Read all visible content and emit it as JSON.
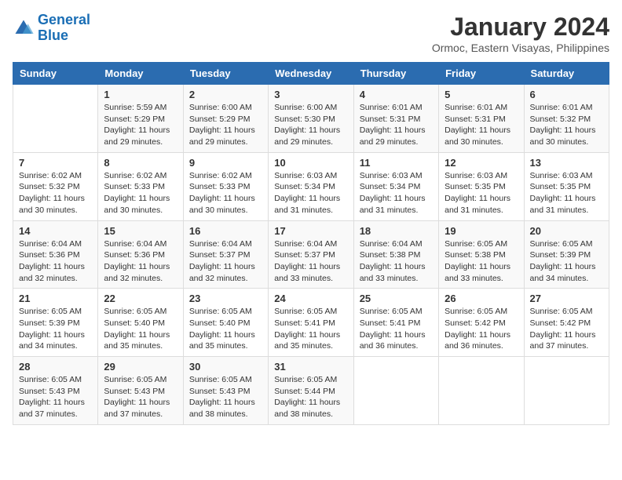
{
  "header": {
    "logo_line1": "General",
    "logo_line2": "Blue",
    "title": "January 2024",
    "subtitle": "Ormoc, Eastern Visayas, Philippines"
  },
  "days_of_week": [
    "Sunday",
    "Monday",
    "Tuesday",
    "Wednesday",
    "Thursday",
    "Friday",
    "Saturday"
  ],
  "weeks": [
    [
      {
        "day": "",
        "content": ""
      },
      {
        "day": "1",
        "content": "Sunrise: 5:59 AM\nSunset: 5:29 PM\nDaylight: 11 hours\nand 29 minutes."
      },
      {
        "day": "2",
        "content": "Sunrise: 6:00 AM\nSunset: 5:29 PM\nDaylight: 11 hours\nand 29 minutes."
      },
      {
        "day": "3",
        "content": "Sunrise: 6:00 AM\nSunset: 5:30 PM\nDaylight: 11 hours\nand 29 minutes."
      },
      {
        "day": "4",
        "content": "Sunrise: 6:01 AM\nSunset: 5:31 PM\nDaylight: 11 hours\nand 29 minutes."
      },
      {
        "day": "5",
        "content": "Sunrise: 6:01 AM\nSunset: 5:31 PM\nDaylight: 11 hours\nand 30 minutes."
      },
      {
        "day": "6",
        "content": "Sunrise: 6:01 AM\nSunset: 5:32 PM\nDaylight: 11 hours\nand 30 minutes."
      }
    ],
    [
      {
        "day": "7",
        "content": "Sunrise: 6:02 AM\nSunset: 5:32 PM\nDaylight: 11 hours\nand 30 minutes."
      },
      {
        "day": "8",
        "content": "Sunrise: 6:02 AM\nSunset: 5:33 PM\nDaylight: 11 hours\nand 30 minutes."
      },
      {
        "day": "9",
        "content": "Sunrise: 6:02 AM\nSunset: 5:33 PM\nDaylight: 11 hours\nand 30 minutes."
      },
      {
        "day": "10",
        "content": "Sunrise: 6:03 AM\nSunset: 5:34 PM\nDaylight: 11 hours\nand 31 minutes."
      },
      {
        "day": "11",
        "content": "Sunrise: 6:03 AM\nSunset: 5:34 PM\nDaylight: 11 hours\nand 31 minutes."
      },
      {
        "day": "12",
        "content": "Sunrise: 6:03 AM\nSunset: 5:35 PM\nDaylight: 11 hours\nand 31 minutes."
      },
      {
        "day": "13",
        "content": "Sunrise: 6:03 AM\nSunset: 5:35 PM\nDaylight: 11 hours\nand 31 minutes."
      }
    ],
    [
      {
        "day": "14",
        "content": "Sunrise: 6:04 AM\nSunset: 5:36 PM\nDaylight: 11 hours\nand 32 minutes."
      },
      {
        "day": "15",
        "content": "Sunrise: 6:04 AM\nSunset: 5:36 PM\nDaylight: 11 hours\nand 32 minutes."
      },
      {
        "day": "16",
        "content": "Sunrise: 6:04 AM\nSunset: 5:37 PM\nDaylight: 11 hours\nand 32 minutes."
      },
      {
        "day": "17",
        "content": "Sunrise: 6:04 AM\nSunset: 5:37 PM\nDaylight: 11 hours\nand 33 minutes."
      },
      {
        "day": "18",
        "content": "Sunrise: 6:04 AM\nSunset: 5:38 PM\nDaylight: 11 hours\nand 33 minutes."
      },
      {
        "day": "19",
        "content": "Sunrise: 6:05 AM\nSunset: 5:38 PM\nDaylight: 11 hours\nand 33 minutes."
      },
      {
        "day": "20",
        "content": "Sunrise: 6:05 AM\nSunset: 5:39 PM\nDaylight: 11 hours\nand 34 minutes."
      }
    ],
    [
      {
        "day": "21",
        "content": "Sunrise: 6:05 AM\nSunset: 5:39 PM\nDaylight: 11 hours\nand 34 minutes."
      },
      {
        "day": "22",
        "content": "Sunrise: 6:05 AM\nSunset: 5:40 PM\nDaylight: 11 hours\nand 35 minutes."
      },
      {
        "day": "23",
        "content": "Sunrise: 6:05 AM\nSunset: 5:40 PM\nDaylight: 11 hours\nand 35 minutes."
      },
      {
        "day": "24",
        "content": "Sunrise: 6:05 AM\nSunset: 5:41 PM\nDaylight: 11 hours\nand 35 minutes."
      },
      {
        "day": "25",
        "content": "Sunrise: 6:05 AM\nSunset: 5:41 PM\nDaylight: 11 hours\nand 36 minutes."
      },
      {
        "day": "26",
        "content": "Sunrise: 6:05 AM\nSunset: 5:42 PM\nDaylight: 11 hours\nand 36 minutes."
      },
      {
        "day": "27",
        "content": "Sunrise: 6:05 AM\nSunset: 5:42 PM\nDaylight: 11 hours\nand 37 minutes."
      }
    ],
    [
      {
        "day": "28",
        "content": "Sunrise: 6:05 AM\nSunset: 5:43 PM\nDaylight: 11 hours\nand 37 minutes."
      },
      {
        "day": "29",
        "content": "Sunrise: 6:05 AM\nSunset: 5:43 PM\nDaylight: 11 hours\nand 37 minutes."
      },
      {
        "day": "30",
        "content": "Sunrise: 6:05 AM\nSunset: 5:43 PM\nDaylight: 11 hours\nand 38 minutes."
      },
      {
        "day": "31",
        "content": "Sunrise: 6:05 AM\nSunset: 5:44 PM\nDaylight: 11 hours\nand 38 minutes."
      },
      {
        "day": "",
        "content": ""
      },
      {
        "day": "",
        "content": ""
      },
      {
        "day": "",
        "content": ""
      }
    ]
  ]
}
